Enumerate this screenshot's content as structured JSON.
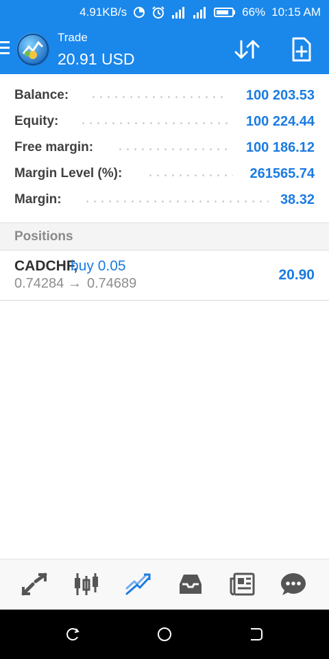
{
  "status_bar": {
    "speed": "4.91KB/s",
    "battery": "66%",
    "time": "10:15 AM",
    "icons": [
      "data-saver-icon",
      "alarm-icon",
      "signal-icon",
      "signal-icon",
      "battery-icon"
    ]
  },
  "app_bar": {
    "title": "Trade",
    "subtitle": "20.91 USD"
  },
  "summary": [
    {
      "label": "Balance:",
      "value": "100 203.53"
    },
    {
      "label": "Equity:",
      "value": "100 224.44"
    },
    {
      "label": "Free margin:",
      "value": "100 186.12"
    },
    {
      "label": "Margin Level (%):",
      "value": "261565.74"
    },
    {
      "label": "Margin:",
      "value": "38.32"
    }
  ],
  "positions": {
    "title": "Positions",
    "items": [
      {
        "symbol": "CADCHF,",
        "side": "buy 0.05",
        "open_price": "0.74284",
        "arrow": "→",
        "current_price": "0.74689",
        "profit": "20.90"
      }
    ]
  },
  "bottom_nav": [
    "quotes-icon",
    "chart-icon",
    "trade-icon",
    "history-icon",
    "news-icon",
    "chat-icon"
  ],
  "colors": {
    "accent": "#1a87eb",
    "value_blue": "#1a7be2"
  }
}
